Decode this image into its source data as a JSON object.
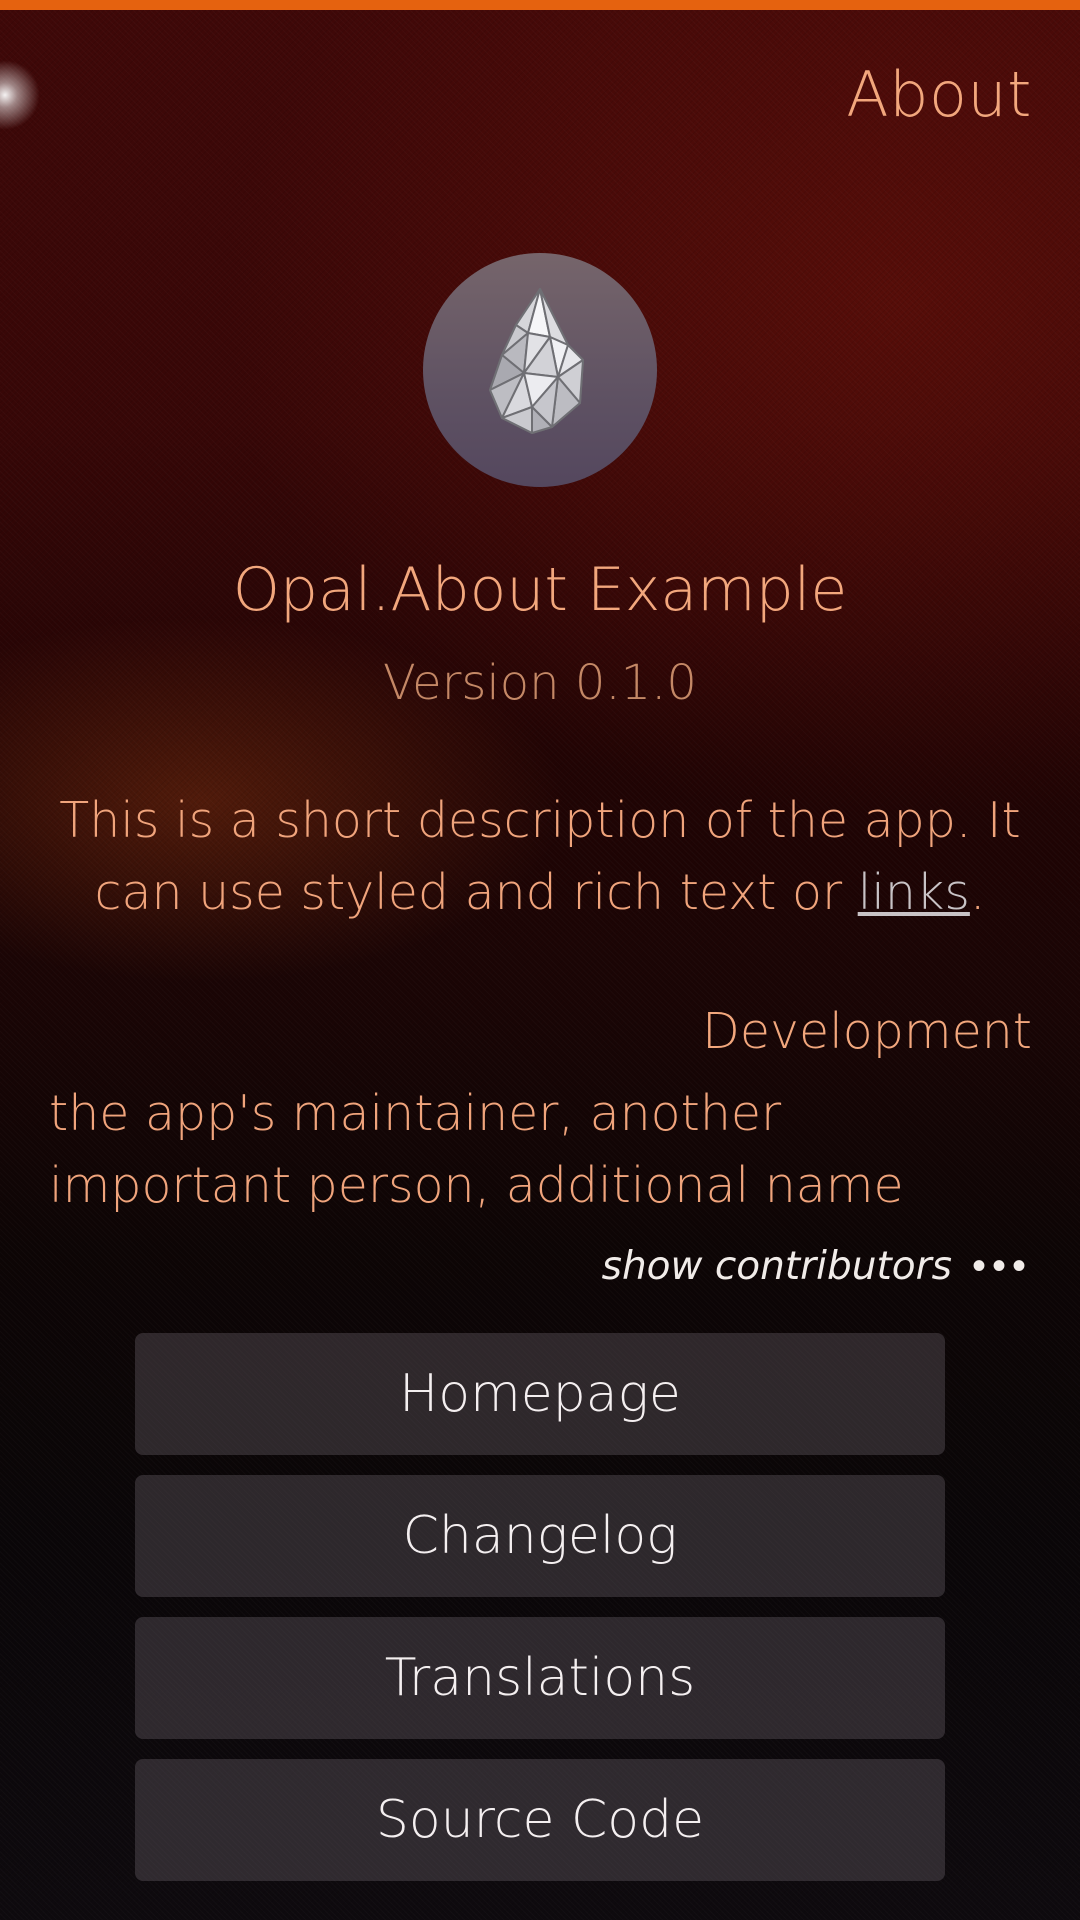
{
  "header": {
    "title": "About"
  },
  "app": {
    "logo_icon": "opal-gem-icon",
    "name": "Opal.About Example",
    "version": "Version 0.1.0",
    "description_before_link": "This is a short description of the app. It can use styled and rich text or ",
    "description_link": "links",
    "description_after_link": "."
  },
  "development": {
    "section_title": "Development",
    "names": "the app's maintainer, another important person, additional name",
    "show_contributors_label": "show contributors",
    "more_icon": "ellipsis-icon"
  },
  "buttons": {
    "homepage": "Homepage",
    "changelog": "Changelog",
    "translations": "Translations",
    "source_code": "Source Code"
  },
  "colors": {
    "accent": "#e5620f",
    "highlight_text": "#f2a77d",
    "secondary_text": "#c48866",
    "link": "#c8c3c6"
  }
}
